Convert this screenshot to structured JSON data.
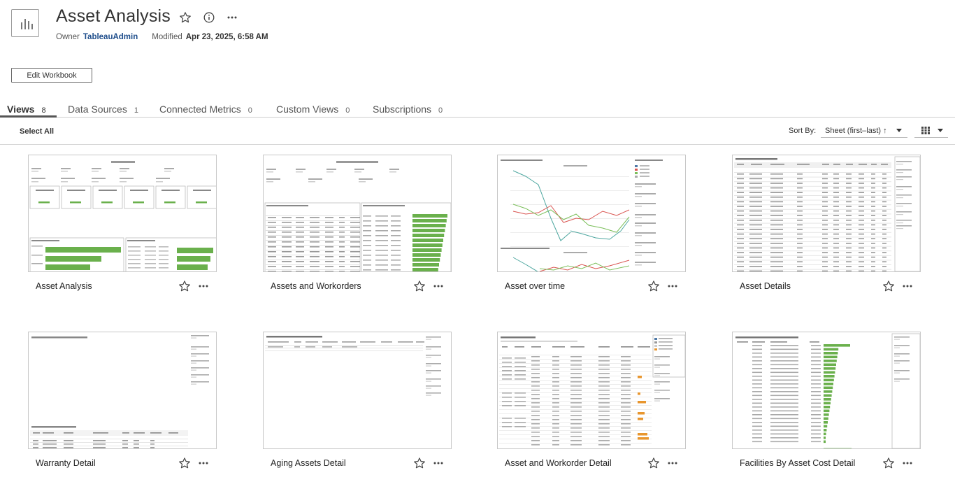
{
  "workbook": {
    "icon": "workbook-chart-icon",
    "title": "Asset Analysis",
    "owner_label": "Owner",
    "owner_name": "TableauAdmin",
    "modified_label": "Modified",
    "modified_value": "Apr 23, 2025, 6:58 AM",
    "edit_button_label": "Edit Workbook"
  },
  "tabs": [
    {
      "label": "Views",
      "count": "8",
      "active": true
    },
    {
      "label": "Data Sources",
      "count": "1",
      "active": false
    },
    {
      "label": "Connected Metrics",
      "count": "0",
      "active": false
    },
    {
      "label": "Custom Views",
      "count": "0",
      "active": false
    },
    {
      "label": "Subscriptions",
      "count": "0",
      "active": false
    }
  ],
  "toolbar": {
    "select_all_label": "Select All",
    "sort_by_label": "Sort By:",
    "sort_by_value": "Sheet (first–last) ↑",
    "view_mode_icon": "grid-view-icon"
  },
  "views": [
    {
      "name": "Asset Analysis",
      "thumb": "kpi-dashboard"
    },
    {
      "name": "Assets and Workorders",
      "thumb": "tables-bars"
    },
    {
      "name": "Asset over time",
      "thumb": "line-charts"
    },
    {
      "name": "Asset Details",
      "thumb": "dense-table"
    },
    {
      "name": "Warranty Detail",
      "thumb": "sparse-table"
    },
    {
      "name": "Aging Assets Detail",
      "thumb": "sparse-header"
    },
    {
      "name": "Asset and Workorder Detail",
      "thumb": "orange-table"
    },
    {
      "name": "Facilities By Asset Cost Detail",
      "thumb": "bar-list"
    }
  ],
  "colors": {
    "bar_green": "#6ab04c",
    "bar_orange": "#e8962e",
    "line_teal": "#4ea7a0",
    "line_red": "#d9534f",
    "line_green": "#7bbf5a",
    "link_blue": "#1f4e8c"
  }
}
